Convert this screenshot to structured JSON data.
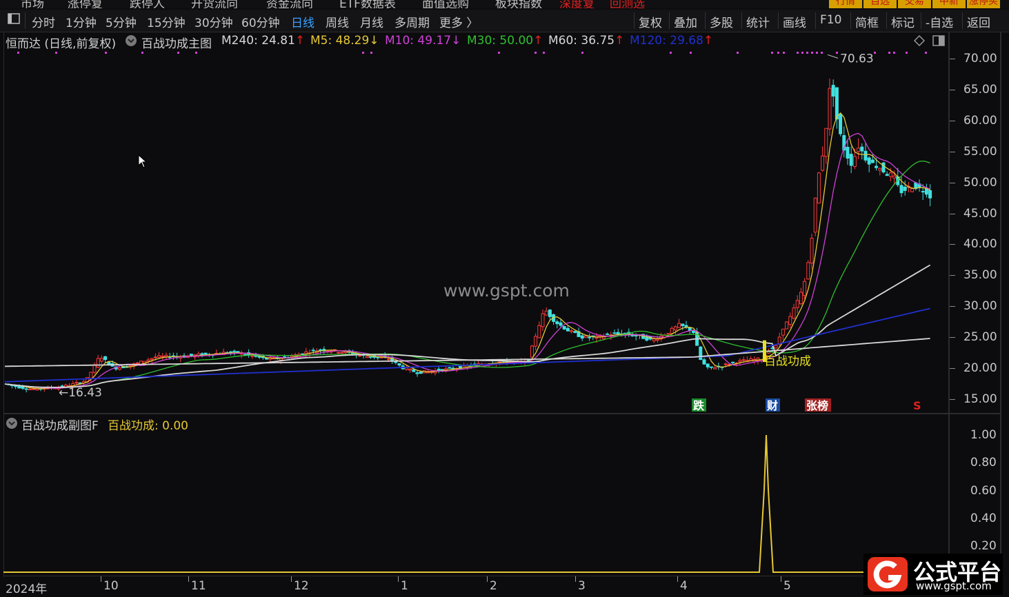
{
  "top_menu": {
    "items": [
      "市场",
      "涨停复",
      "跌停人",
      "开货流向",
      "资金流向",
      "ETF数据表",
      "面值选购",
      "板块指数"
    ],
    "red_items": [
      "深度复",
      "回测选"
    ],
    "right_buttons": [
      "行情",
      "自选",
      "交易",
      "中新",
      "涨停买"
    ]
  },
  "toolbar": {
    "panel_toggle": "◫",
    "periods": [
      "分时",
      "1分钟",
      "5分钟",
      "15分钟",
      "30分钟",
      "60分钟",
      "日线",
      "周线",
      "月线",
      "多周期",
      "更多 〉"
    ],
    "active_period": "日线",
    "actions": [
      "复权",
      "叠加",
      "多股",
      "统计",
      "画线",
      "F10",
      "简框",
      "标记",
      "-自选",
      "返回"
    ]
  },
  "main_header": {
    "title": "恒而达 (日线,前复权)",
    "indicator": "百战功成主图",
    "ma": [
      {
        "label": "M240: 24.81",
        "arrow": "↑",
        "color": "#d8d8d8",
        "arrow_color": "#e02020"
      },
      {
        "label": "M5: 48.29",
        "arrow": "↓",
        "color": "#e6c832",
        "arrow_color": "#e6c832"
      },
      {
        "label": "M10: 49.17",
        "arrow": "↓",
        "color": "#d040d8",
        "arrow_color": "#d040d8"
      },
      {
        "label": "M30: 50.00",
        "arrow": "↑",
        "color": "#30c030",
        "arrow_color": "#e02020"
      },
      {
        "label": "M60: 36.75",
        "arrow": "↑",
        "color": "#d8d8d8",
        "arrow_color": "#e02020"
      },
      {
        "label": "M120: 29.68",
        "arrow": "↑",
        "color": "#2030d0",
        "arrow_color": "#e02020"
      }
    ]
  },
  "main_axis": [
    "70.00",
    "65.00",
    "60.00",
    "55.00",
    "50.00",
    "45.00",
    "40.00",
    "35.00",
    "30.00",
    "25.00",
    "20.00",
    "15.00"
  ],
  "annotations": {
    "high": "70.63",
    "low": "16.43",
    "signal_text": "百战功成",
    "markers": [
      {
        "text": "跌",
        "color": "#ffffff",
        "bg": "#1a8a2a"
      },
      {
        "text": "财",
        "color": "#ffffff",
        "bg": "#1a4aa0"
      },
      {
        "text": "张榜",
        "color": "#ffffff",
        "bg": "#a02020"
      },
      {
        "text": "S",
        "color": "#e02020",
        "bg": "transparent"
      }
    ]
  },
  "sub_header": {
    "title": "百战功成副图F",
    "value_label": "百战功成: 0.00",
    "value_color": "#e6c832"
  },
  "sub_axis": [
    "1.00",
    "0.80",
    "0.60",
    "0.40",
    "0.20"
  ],
  "x_axis": [
    "2024年",
    "10",
    "11",
    "12",
    "1",
    "2",
    "3",
    "4",
    "5"
  ],
  "watermark": "www.gspt.com",
  "logo": {
    "title": "公式平台",
    "url": "www.gspt.com"
  },
  "chart_data": {
    "type": "candlestick",
    "title": "恒而达 (日线,前复权)",
    "y_range": [
      15,
      72
    ],
    "sub_y_range": [
      0,
      1
    ],
    "x_labels": [
      "2024年",
      "10",
      "11",
      "12",
      "1",
      "2",
      "3",
      "4",
      "5"
    ],
    "price_high": 70.63,
    "price_low": 16.43,
    "series": [
      {
        "name": "M240",
        "last": 24.81,
        "color": "#d8d8d8"
      },
      {
        "name": "M5",
        "last": 48.29,
        "color": "#e6c832"
      },
      {
        "name": "M10",
        "last": 49.17,
        "color": "#d040d8"
      },
      {
        "name": "M30",
        "last": 50.0,
        "color": "#30c030"
      },
      {
        "name": "M60",
        "last": 36.75,
        "color": "#d8d8d8"
      },
      {
        "name": "M120",
        "last": 29.68,
        "color": "#2030d0"
      }
    ],
    "sub_series": {
      "name": "百战功成",
      "last": 0.0,
      "peak": 1.0,
      "color": "#e6c832"
    },
    "close_trend": [
      [
        0,
        17.5
      ],
      [
        20,
        17.0
      ],
      [
        40,
        16.6
      ],
      [
        60,
        16.8
      ],
      [
        80,
        16.9
      ],
      [
        100,
        17.4
      ],
      [
        120,
        18.0
      ],
      [
        140,
        22.0
      ],
      [
        160,
        20.0
      ],
      [
        180,
        20.3
      ],
      [
        200,
        21.0
      ],
      [
        220,
        21.8
      ],
      [
        240,
        21.9
      ],
      [
        260,
        21.9
      ],
      [
        280,
        22.1
      ],
      [
        300,
        22.3
      ],
      [
        320,
        22.5
      ],
      [
        340,
        22.5
      ],
      [
        360,
        22.0
      ],
      [
        380,
        21.5
      ],
      [
        400,
        21.6
      ],
      [
        420,
        22.0
      ],
      [
        440,
        22.6
      ],
      [
        460,
        23.0
      ],
      [
        480,
        22.8
      ],
      [
        500,
        22.5
      ],
      [
        520,
        22.0
      ],
      [
        540,
        21.8
      ],
      [
        560,
        21.5
      ],
      [
        580,
        20.0
      ],
      [
        600,
        19.3
      ],
      [
        620,
        19.5
      ],
      [
        640,
        19.8
      ],
      [
        660,
        20.1
      ],
      [
        680,
        20.5
      ],
      [
        700,
        20.8
      ],
      [
        720,
        21.0
      ],
      [
        740,
        21.0
      ],
      [
        760,
        21.0
      ],
      [
        775,
        26.5
      ],
      [
        785,
        29.5
      ],
      [
        800,
        27.5
      ],
      [
        820,
        26.0
      ],
      [
        840,
        25.0
      ],
      [
        860,
        25.0
      ],
      [
        880,
        25.5
      ],
      [
        900,
        25.5
      ],
      [
        920,
        25.2
      ],
      [
        940,
        24.5
      ],
      [
        960,
        25.5
      ],
      [
        980,
        27.0
      ],
      [
        1000,
        26.0
      ],
      [
        1010,
        21.5
      ],
      [
        1020,
        20.0
      ],
      [
        1040,
        20.3
      ],
      [
        1060,
        21.0
      ],
      [
        1080,
        21.3
      ],
      [
        1100,
        21.5
      ],
      [
        1110,
        23.0
      ],
      [
        1120,
        23.5
      ],
      [
        1130,
        26.5
      ],
      [
        1140,
        28.0
      ],
      [
        1150,
        30.5
      ],
      [
        1160,
        33.0
      ],
      [
        1170,
        39.0
      ],
      [
        1175,
        45.0
      ],
      [
        1180,
        50.0
      ],
      [
        1190,
        56.0
      ],
      [
        1200,
        67.0
      ],
      [
        1210,
        59.0
      ],
      [
        1220,
        55.0
      ],
      [
        1230,
        53.0
      ],
      [
        1240,
        56.0
      ],
      [
        1250,
        54.0
      ],
      [
        1260,
        53.0
      ],
      [
        1270,
        52.5
      ],
      [
        1280,
        51.5
      ],
      [
        1290,
        51.0
      ],
      [
        1300,
        48.5
      ],
      [
        1310,
        49.0
      ],
      [
        1320,
        49.5
      ],
      [
        1330,
        49.0
      ],
      [
        1340,
        48.5
      ],
      [
        1345,
        47.5
      ]
    ]
  }
}
